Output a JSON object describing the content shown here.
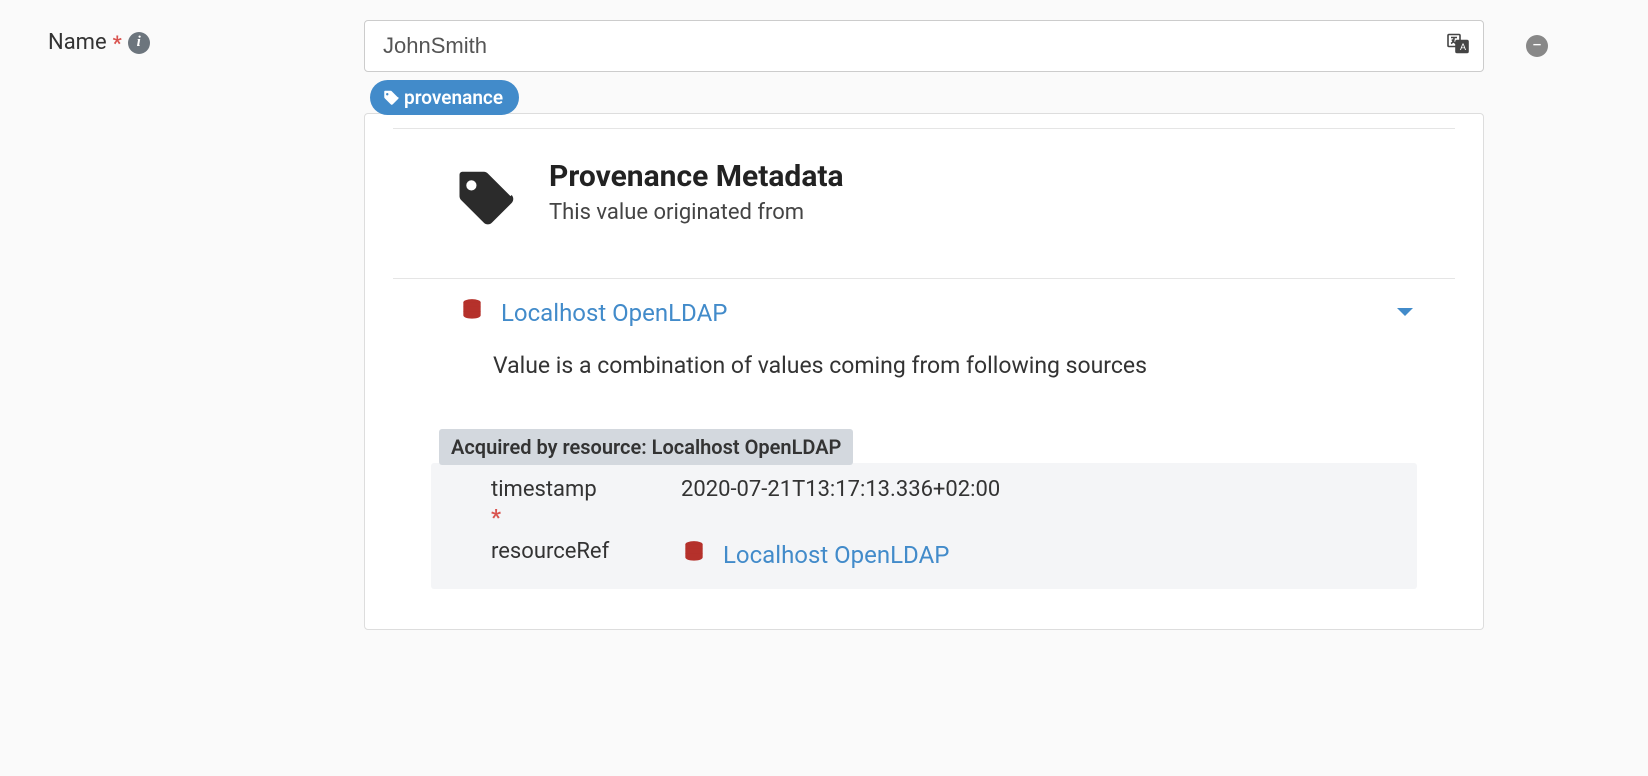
{
  "form": {
    "name_label": "Name",
    "name_value": "JohnSmith"
  },
  "badge": {
    "provenance": "provenance"
  },
  "panel": {
    "title": "Provenance Metadata",
    "subtitle": "This value originated from",
    "source_link": "Localhost OpenLDAP",
    "combination_text": "Value is a combination of values coming from following sources",
    "acquired_label": "Acquired by resource: Localhost OpenLDAP",
    "rows": {
      "timestamp_key": "timestamp",
      "timestamp_val": "2020-07-21T13:17:13.336+02:00",
      "resourceref_key": "resourceRef",
      "resourceref_link": "Localhost OpenLDAP"
    }
  }
}
